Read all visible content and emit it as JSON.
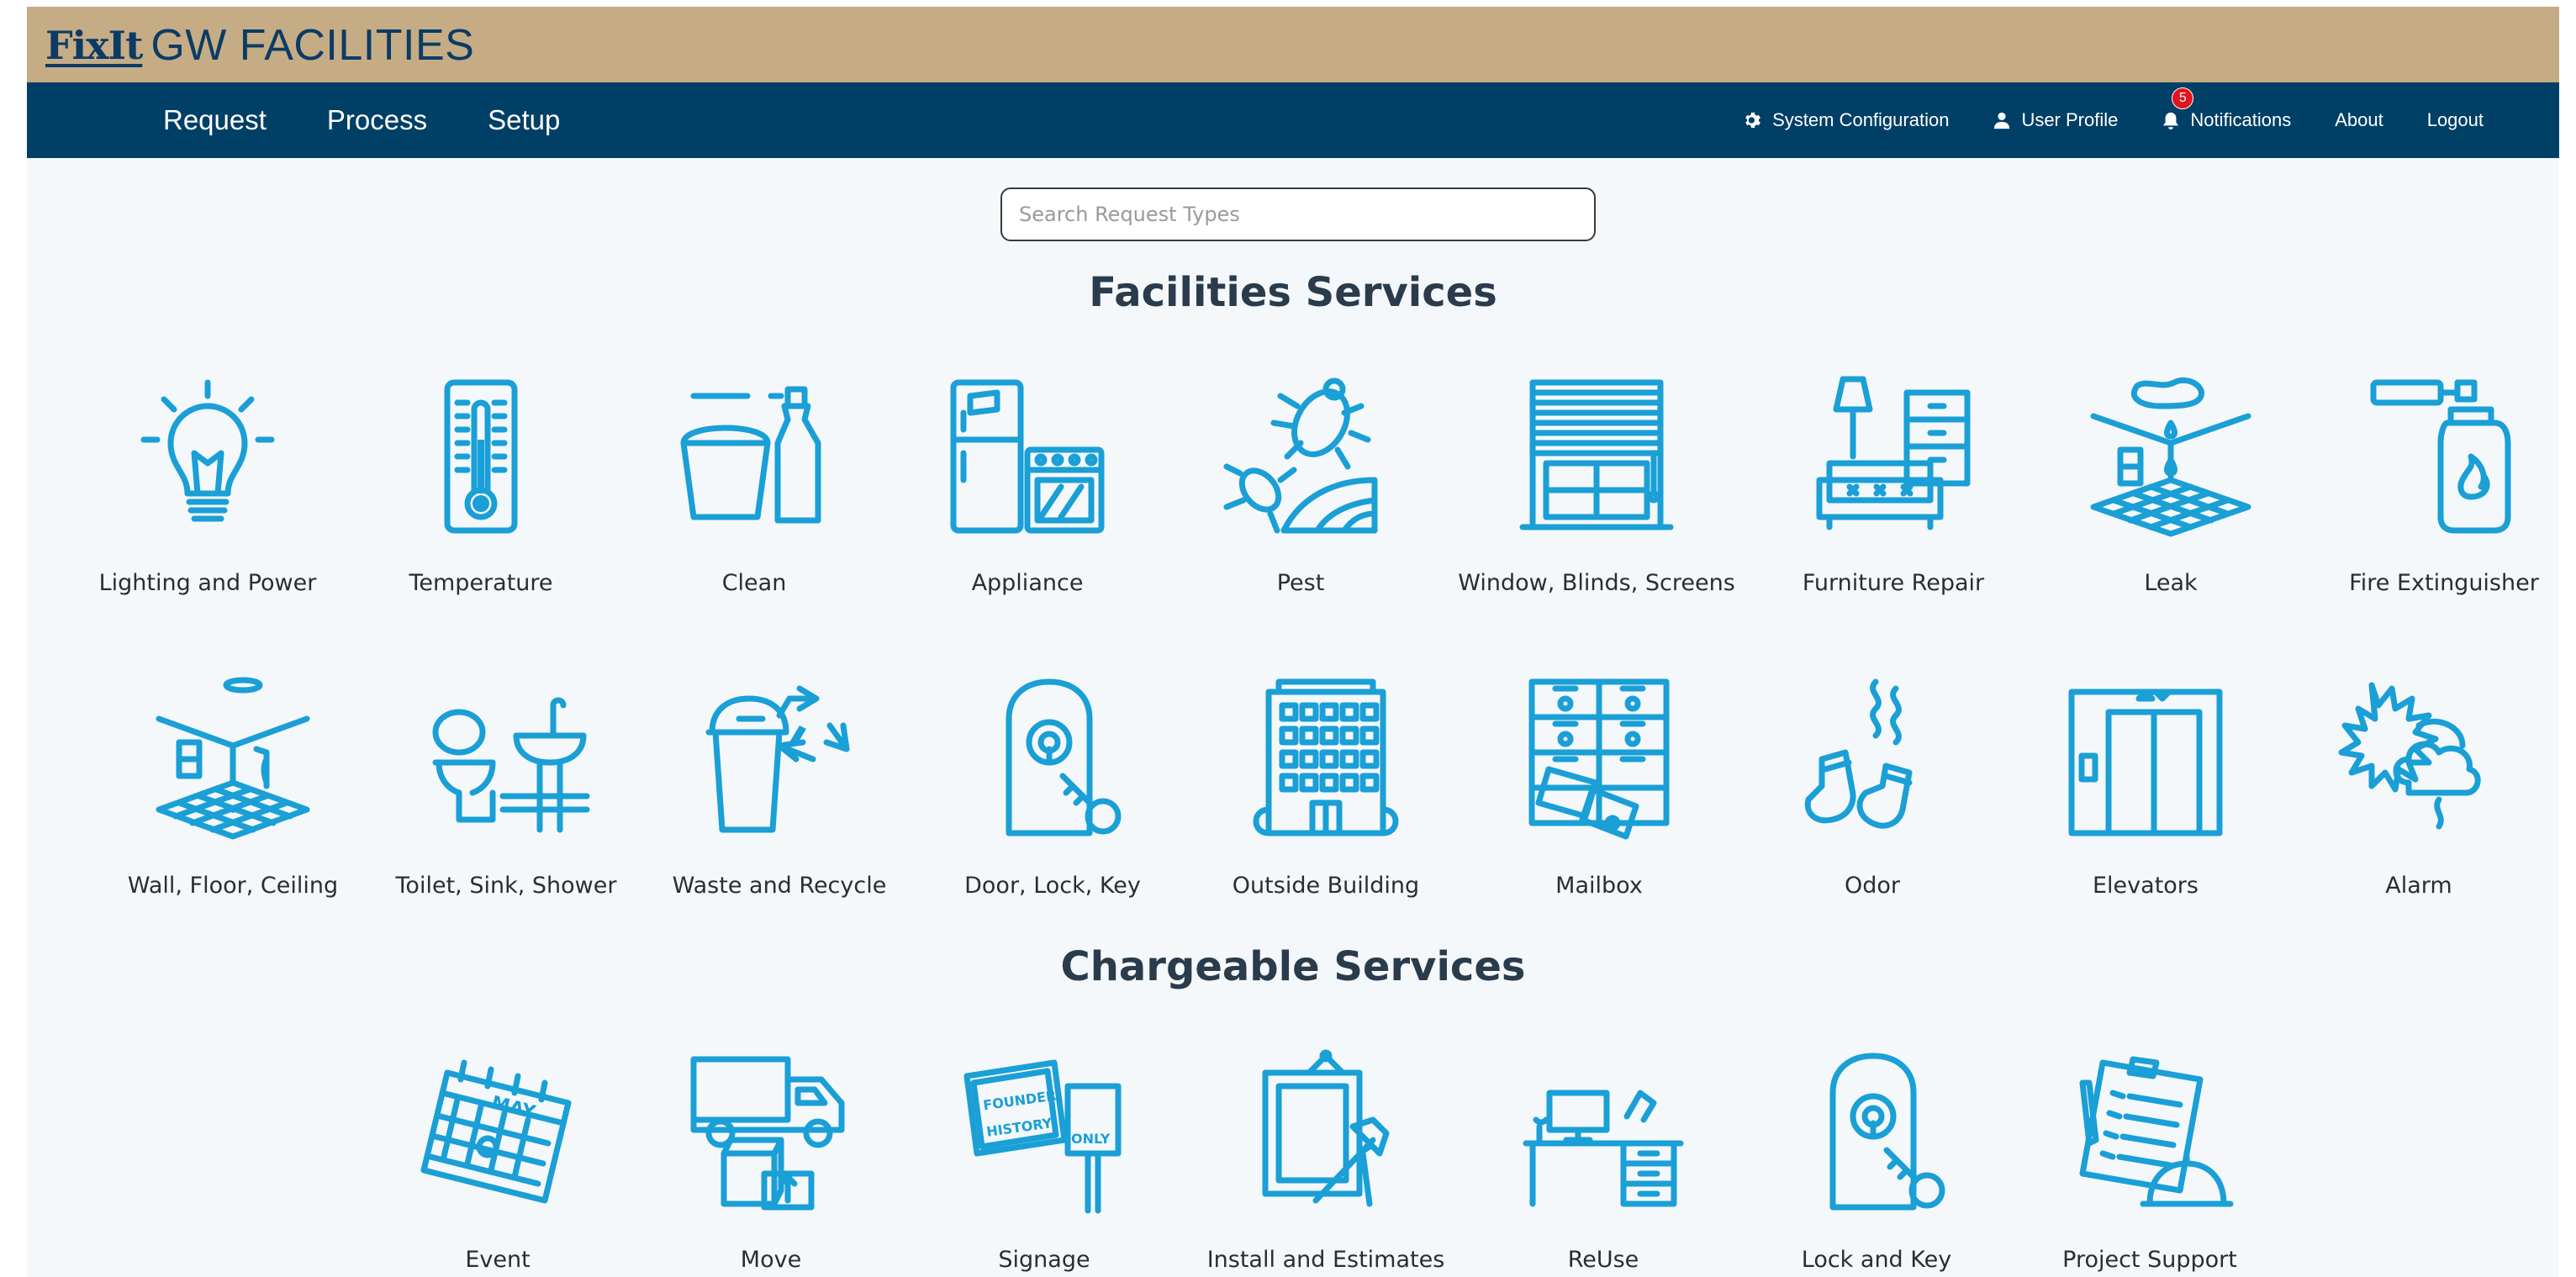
{
  "brand": {
    "logo_text": "FixIt",
    "app_name": "GW FACILITIES",
    "colors": {
      "brand_bar": "#c6ac84",
      "nav_bar": "#003f66",
      "icon_stroke": "#1a9fd6",
      "badge": "#e0161e"
    }
  },
  "nav": {
    "left": [
      "Request",
      "Process",
      "Setup"
    ],
    "right": {
      "system_configuration": "System Configuration",
      "user_profile": "User Profile",
      "notifications": "Notifications",
      "notifications_count": "5",
      "about": "About",
      "logout": "Logout"
    }
  },
  "search": {
    "placeholder": "Search Request Types",
    "value": ""
  },
  "facilities": {
    "title": "Facilities Services",
    "items": [
      {
        "label": "Lighting and Power",
        "icon": "light-bulb-icon"
      },
      {
        "label": "Temperature",
        "icon": "thermometer-icon"
      },
      {
        "label": "Clean",
        "icon": "bucket-spray-icon"
      },
      {
        "label": "Appliance",
        "icon": "fridge-stove-icon"
      },
      {
        "label": "Pest",
        "icon": "bug-icon"
      },
      {
        "label": "Window, Blinds, Screens",
        "icon": "window-blinds-icon"
      },
      {
        "label": "Furniture Repair",
        "icon": "sofa-dresser-icon"
      },
      {
        "label": "Leak",
        "icon": "ceiling-leak-icon"
      },
      {
        "label": "Fire Extinguisher",
        "icon": "fire-extinguisher-icon"
      },
      {
        "label": "Wall, Floor, Ceiling",
        "icon": "room-corner-icon"
      },
      {
        "label": "Toilet, Sink, Shower",
        "icon": "toilet-sink-icon"
      },
      {
        "label": "Waste and Recycle",
        "icon": "trash-recycle-icon"
      },
      {
        "label": "Door, Lock, Key",
        "icon": "door-lock-key-icon"
      },
      {
        "label": "Outside Building",
        "icon": "building-icon"
      },
      {
        "label": "Mailbox",
        "icon": "mailbox-icon"
      },
      {
        "label": "Odor",
        "icon": "socks-odor-icon"
      },
      {
        "label": "Elevators",
        "icon": "elevator-icon"
      },
      {
        "label": "Alarm",
        "icon": "smoke-alarm-icon"
      }
    ]
  },
  "chargeable": {
    "title": "Chargeable Services",
    "items": [
      {
        "label": "Event",
        "icon": "calendar-icon"
      },
      {
        "label": "Move",
        "icon": "moving-truck-icon"
      },
      {
        "label": "Signage",
        "icon": "signs-icon"
      },
      {
        "label": "Install and Estimates",
        "icon": "frame-hammer-icon"
      },
      {
        "label": "ReUse",
        "icon": "desk-icon"
      },
      {
        "label": "Lock and Key",
        "icon": "lock-key-icon"
      },
      {
        "label": "Project Support",
        "icon": "clipboard-hardhat-icon"
      }
    ],
    "calendar_month": "MAY",
    "sign_texts": [
      "FOUNDER",
      "HISTORY",
      "ONLY"
    ]
  }
}
